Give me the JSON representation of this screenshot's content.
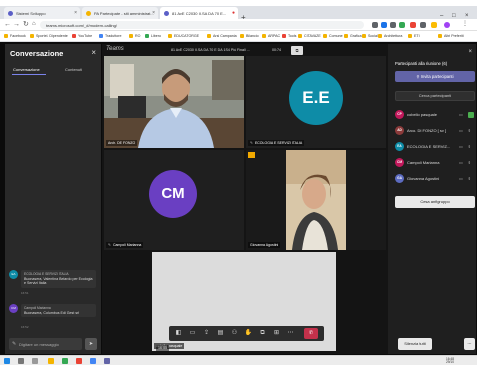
{
  "browser": {
    "tabs": [
      {
        "label": "Sistemi Sviluppo"
      },
      {
        "label": "PA Partecipate - siti amministrat..."
      },
      {
        "label": "81 AvE C2030 II.SA DA 70 E..."
      }
    ],
    "new_tab_label": "+",
    "url": "teams.microsoft.com/_#/modern-calling/",
    "bookmarks": [
      "Facebook",
      "Sportel. Dipendente",
      "YouTube",
      "Traduttore",
      "RO",
      "Libero",
      "EDUCATORGE",
      "Arsi Campania",
      "Bilancio",
      "ARPAC",
      "Tools",
      "CITAVAZE",
      "Comune",
      "Grafica",
      "Social",
      "Architettura",
      "ETI",
      "Altri Preferiti"
    ]
  },
  "chat": {
    "title": "Conversazione",
    "tabs": [
      "Conversazione",
      "Contenuti"
    ],
    "messages": [
      {
        "avatar": "EA",
        "author": "ECOLOGIA E SERVIZI ITALIA",
        "text": "Buonasera, Valentina Belardo per Ecologia e Servizi Italia",
        "time": "16:51"
      },
      {
        "avatar": "CM",
        "author": "Campoli Marianna",
        "text": "Buonasera, Columbus Edi Gest srl",
        "time": "16:52"
      }
    ],
    "compose_placeholder": "Digitare un messaggio",
    "send_icon": "➤"
  },
  "meeting": {
    "app_name": "Teams",
    "title": "81 AvE C2030 II.SA DA 70 E DA 1S4 Più Finali ...",
    "elapsed": "00:74"
  },
  "tiles": [
    {
      "label": "Arch. DE FONZO",
      "type": "video"
    },
    {
      "label": "ECOLOGIA E SERVIZI ITALIA",
      "initials": "E.E",
      "color": "#0e8ca7",
      "type": "avatar"
    },
    {
      "label": "Campoli Marianna",
      "initials": "CM",
      "color": "#6a3fc2",
      "type": "avatar"
    },
    {
      "label": "Giovanna Agostini",
      "type": "video"
    },
    {
      "label": "cobello pasquale",
      "type": "video"
    }
  ],
  "toolbar": {
    "buttons": [
      "camera-icon",
      "video-icon",
      "share-icon",
      "chat-icon",
      "people-icon",
      "hand-icon",
      "more-icon",
      "apps-icon",
      "ellipsis-icon"
    ],
    "hangup_label": "✆",
    "overlay_time": "16:55"
  },
  "participants_panel": {
    "title": "Partecipanti alla riunione (6)",
    "invite_label": "Invita partecipanti",
    "search_placeholder": "Cerca partecipanti",
    "participants": [
      {
        "name": "cobello pasquale",
        "initials": "CP",
        "color": "#c2185b"
      },
      {
        "name": "Arco. DI FONZO [ sv ]",
        "initials": "AD",
        "color": "#8b3a3a"
      },
      {
        "name": "ECOLOGIA E SERVIZ...",
        "initials": "EA",
        "color": "#0e8ca7"
      },
      {
        "name": "Campoli Marianna",
        "initials": "CM",
        "color": "#c2185b"
      },
      {
        "name": "Giovanna Agostini",
        "initials": "GA",
        "color": "#5c6bc0"
      }
    ],
    "share_label": "Cesa anfigruppo",
    "mute_all_label": "Silenzia tutti",
    "more_label": "..."
  },
  "taskbar": {
    "time": "16:48",
    "date": "29/10"
  },
  "colors": {
    "accent": "#6264a7",
    "hangup": "#c4314b",
    "dark_bg": "#1f1f1f"
  }
}
